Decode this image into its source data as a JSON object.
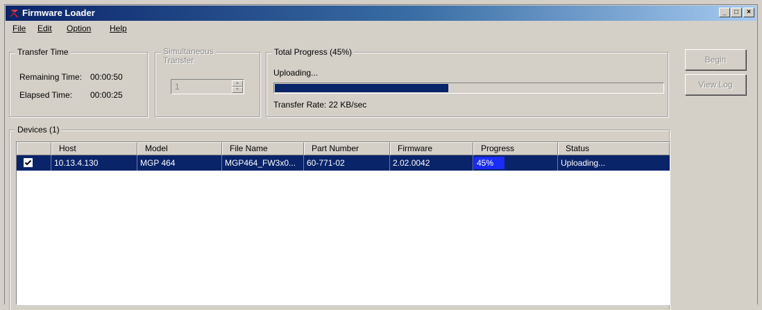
{
  "window": {
    "title": "Firmware Loader",
    "caption_buttons": [
      "_",
      "□",
      "×"
    ]
  },
  "menu": [
    {
      "label": "File",
      "mnemonic_index": 0
    },
    {
      "label": "Edit",
      "mnemonic_index": 0
    },
    {
      "label": "Option",
      "mnemonic_index": 0
    },
    {
      "label": "Help",
      "mnemonic_index": 0
    }
  ],
  "transfer_time": {
    "legend": "Transfer Time",
    "remaining_label": "Remaining Time:",
    "remaining_value": "00:00:50",
    "elapsed_label": "Elapsed Time:",
    "elapsed_value": "00:00:25"
  },
  "simultaneous": {
    "legend_line1": "Simultaneous",
    "legend_line2": "Transfer",
    "value": "1"
  },
  "total_progress": {
    "legend": "Total Progress (45%)",
    "status": "Uploading...",
    "percent": 45,
    "rate": "Transfer Rate: 22 KB/sec"
  },
  "buttons": {
    "begin": "Begin",
    "view_log": "View Log"
  },
  "devices": {
    "legend": "Devices (1)",
    "columns": [
      "",
      "Host",
      "Model",
      "File Name",
      "Part Number",
      "Firmware",
      "Progress",
      "Status"
    ],
    "rows": [
      {
        "checked": true,
        "host": "10.13.4.130",
        "model": "MGP 464",
        "file_name": "MGP464_FW3x0...",
        "part_number": "60-771-02",
        "firmware": "2.02.0042",
        "progress": "45%",
        "status": "Uploading..."
      }
    ]
  },
  "colors": {
    "selection": "#0a246a",
    "progress_badge": "#1a2cf5",
    "face": "#d4d0c8"
  }
}
